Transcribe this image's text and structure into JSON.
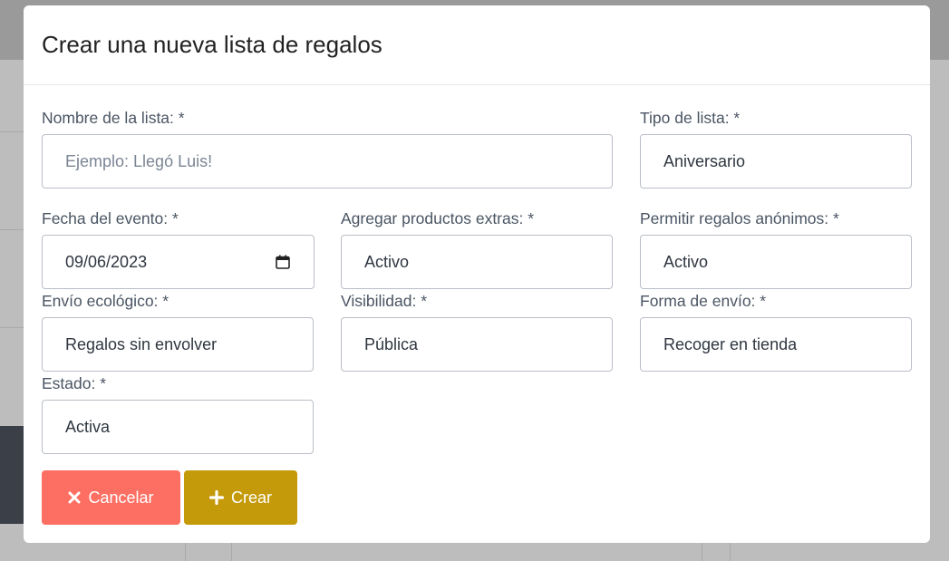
{
  "modal": {
    "title": "Crear una nueva lista de regalos"
  },
  "form": {
    "list_name": {
      "label": "Nombre de la lista: *",
      "placeholder": "Ejemplo: Llegó Luis!"
    },
    "list_type": {
      "label": "Tipo de lista: *",
      "value": "Aniversario"
    },
    "event_date": {
      "label": "Fecha del evento: *",
      "value": "09/06/2023"
    },
    "extra_products": {
      "label": "Agregar productos extras: *",
      "value": "Activo"
    },
    "anonymous_gifts": {
      "label": "Permitir regalos anónimos: *",
      "value": "Activo"
    },
    "eco_shipping": {
      "label": "Envío ecológico: *",
      "value": "Regalos sin envolver"
    },
    "visibility": {
      "label": "Visibilidad: *",
      "value": "Pública"
    },
    "shipping_method": {
      "label": "Forma de envío: *",
      "value": "Recoger en tienda"
    },
    "status": {
      "label": "Estado: *",
      "value": "Activa"
    }
  },
  "buttons": {
    "cancel_label": "Cancelar",
    "create_label": "Crear"
  },
  "icons": {
    "cancel": "times-icon",
    "create": "plus-icon",
    "date": "calendar-icon"
  },
  "colors": {
    "cancel_button": "#fd6f63",
    "create_button": "#c49a0a"
  }
}
